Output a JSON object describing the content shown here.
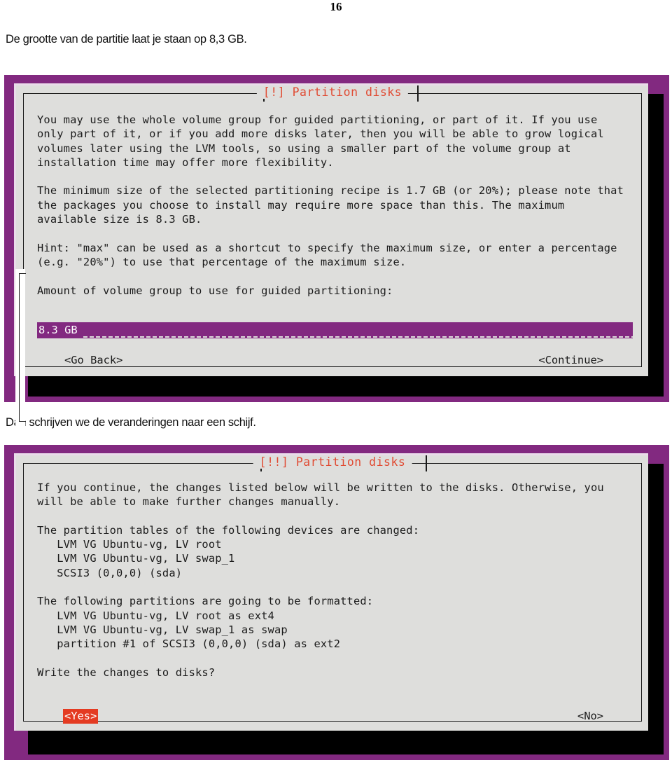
{
  "document": {
    "page_number": "16",
    "paragraph_1": "De grootte van de partitie laat je staan op 8,3 GB.",
    "paragraph_2": "Dan schrijven we de veranderingen naar een schijf."
  },
  "colors": {
    "terminal_frame_purple": "#822980",
    "dialog_background": "#dededc",
    "dialog_text": "#1b1b1b",
    "title_red": "#e04a32",
    "selected_button_red": "#e43b22",
    "input_highlight_purple": "#822980",
    "shadow_black": "#000000"
  },
  "dialog_1": {
    "title": "[!] Partition disks",
    "body": "You may use the whole volume group for guided partitioning, or part of it. If you use\nonly part of it, or if you add more disks later, then you will be able to grow logical\nvolumes later using the LVM tools, so using a smaller part of the volume group at\ninstallation time may offer more flexibility.\n\nThe minimum size of the selected partitioning recipe is 1.7 GB (or 20%); please note that\nthe packages you choose to install may require more space than this. The maximum\navailable size is 8.3 GB.\n\nHint: \"max\" can be used as a shortcut to specify the maximum size, or enter a percentage\n(e.g. \"20%\") to use that percentage of the maximum size.\n\nAmount of volume group to use for guided partitioning:",
    "input": {
      "value": "8.3 GB",
      "placeholder": "8.3 GB"
    },
    "buttons": {
      "back": "<Go Back>",
      "continue": "<Continue>"
    }
  },
  "dialog_2": {
    "title": "[!!] Partition disks",
    "body": "If you continue, the changes listed below will be written to the disks. Otherwise, you\nwill be able to make further changes manually.\n\nThe partition tables of the following devices are changed:\n   LVM VG Ubuntu-vg, LV root\n   LVM VG Ubuntu-vg, LV swap_1\n   SCSI3 (0,0,0) (sda)\n\nThe following partitions are going to be formatted:\n   LVM VG Ubuntu-vg, LV root as ext4\n   LVM VG Ubuntu-vg, LV swap_1 as swap\n   partition #1 of SCSI3 (0,0,0) (sda) as ext2\n\nWrite the changes to disks?",
    "buttons": {
      "yes": "<Yes>",
      "no": "<No>"
    }
  }
}
